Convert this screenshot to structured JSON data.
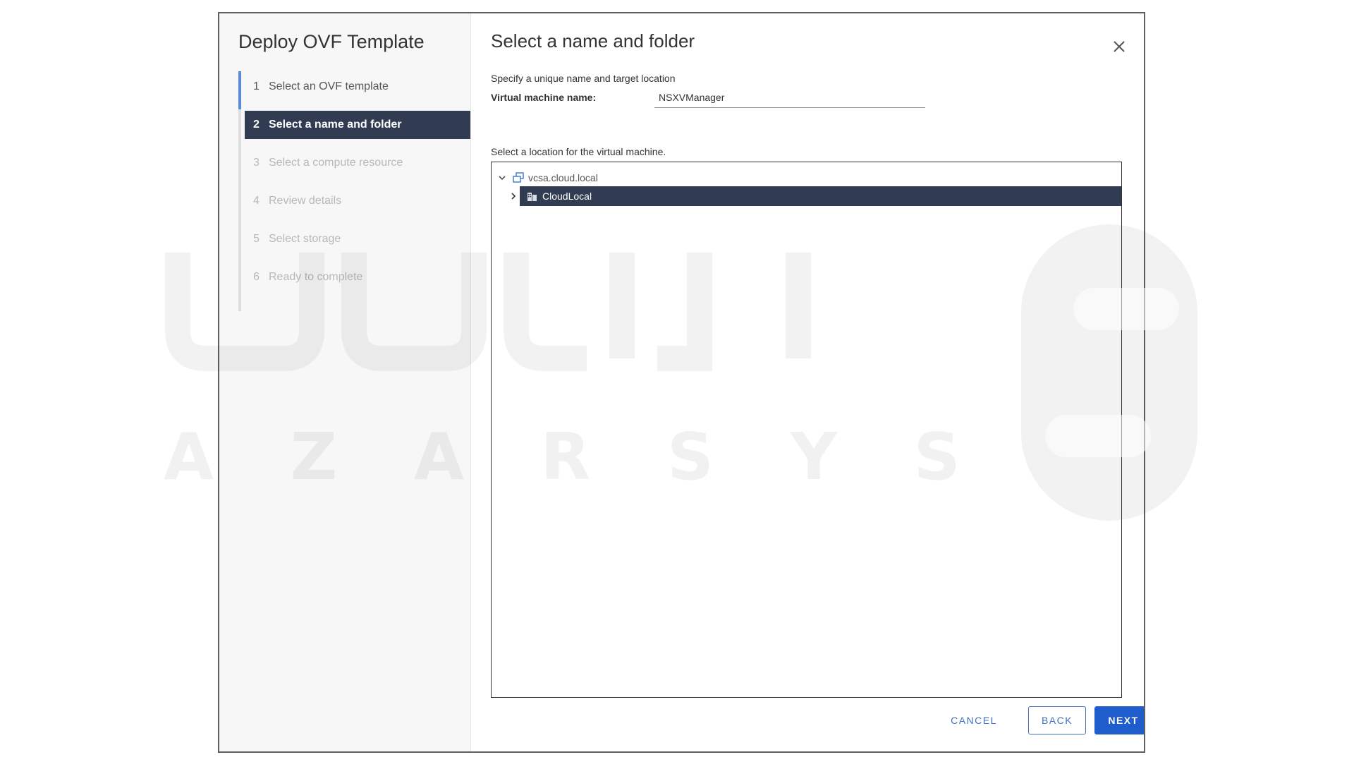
{
  "dialog": {
    "wizard_title": "Deploy OVF Template",
    "steps": [
      {
        "num": "1",
        "label": "Select an OVF template",
        "state": "completed"
      },
      {
        "num": "2",
        "label": "Select a name and folder",
        "state": "active"
      },
      {
        "num": "3",
        "label": "Select a compute resource",
        "state": "disabled"
      },
      {
        "num": "4",
        "label": "Review details",
        "state": "disabled"
      },
      {
        "num": "5",
        "label": "Select storage",
        "state": "disabled"
      },
      {
        "num": "6",
        "label": "Ready to complete",
        "state": "disabled"
      }
    ],
    "page_title": "Select a name and folder",
    "subtitle": "Specify a unique name and target location",
    "vm_name_label": "Virtual machine name:",
    "vm_name_value": "NSXVManager",
    "location_label": "Select a location for the virtual machine.",
    "tree": {
      "root": {
        "label": "vcsa.cloud.local",
        "icon": "vcenter-icon",
        "expanded": true
      },
      "children": [
        {
          "label": "CloudLocal",
          "icon": "datacenter-icon",
          "expanded": false,
          "selected": true
        }
      ]
    },
    "buttons": {
      "cancel": "CANCEL",
      "back": "BACK",
      "next": "NEXT"
    }
  },
  "watermark": {
    "latin": [
      "A",
      "Z",
      "A",
      "R",
      "S",
      "Y",
      "S"
    ]
  },
  "colors": {
    "accent": "#1f5ccc",
    "selected_bg": "#313c52",
    "step_indicator": "#5b8bd4"
  }
}
